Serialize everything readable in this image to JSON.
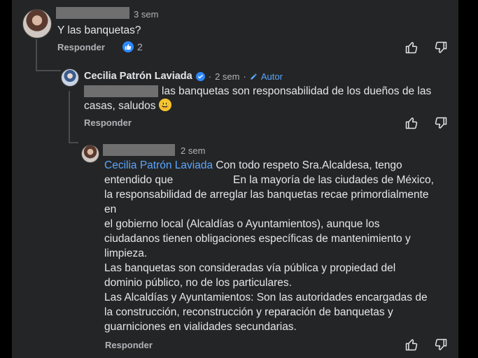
{
  "comment1": {
    "time": "3 sem",
    "text": "Y las banquetas?",
    "reply_label": "Responder",
    "reaction_count": "2"
  },
  "comment2": {
    "author": "Cecilia Patrón Laviada",
    "separator": "·",
    "time": "2 sem",
    "author_tag": "Autor",
    "text_line1": "las banquetas son responsabilidad de los dueños de las",
    "text_line2": "casas, saludos",
    "emoji": "😃",
    "reply_label": "Responder"
  },
  "comment3": {
    "time": "2 sem",
    "mention": "Cecilia Patrón Laviada",
    "lines": [
      "Con todo respeto Sra.Alcaldesa, tengo",
      "entendido que",
      "En la mayoría de las ciudades de México,",
      "la responsabilidad de arreglar las banquetas recae primordialmente",
      "en",
      "el gobierno local (Alcaldías o Ayuntamientos), aunque los",
      "ciudadanos tienen obligaciones específicas de mantenimiento y",
      "limpieza.",
      "Las banquetas son consideradas vía pública y propiedad del",
      "dominio público, no de los particulares.",
      "Las Alcaldías y Ayuntamientos: Son las autoridades encargadas de",
      "la construcción, reconstrucción y reparación de banquetas y",
      "guarniciones en vialidades secundarias."
    ],
    "reply_label": "Responder"
  },
  "icons": {
    "like": "thumbs-up-icon",
    "dislike": "thumbs-down-icon",
    "verified": "verified-badge-icon",
    "author": "pencil-icon"
  },
  "colors": {
    "background": "#242526",
    "accent": "#2d88ff",
    "mention": "#5aa7ff",
    "muted": "#b0b3b8"
  }
}
